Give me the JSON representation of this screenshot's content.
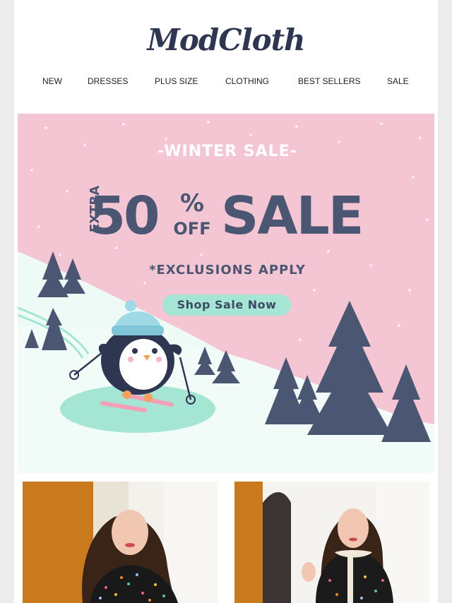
{
  "brand": {
    "name": "ModCloth"
  },
  "nav": {
    "items": [
      {
        "label": "NEW"
      },
      {
        "label": "DRESSES"
      },
      {
        "label": "PLUS SIZE"
      },
      {
        "label": "CLOTHING"
      },
      {
        "label": "BEST SELLERS"
      },
      {
        "label": "SALE"
      }
    ]
  },
  "hero": {
    "kicker": "-WINTER SALE-",
    "extra": "EXTRA",
    "percent": "50",
    "percent_sign": "%",
    "off": "OFF",
    "sale_word": "SALE",
    "exclusions": "*EXCLUSIONS APPLY",
    "cta_label": "Shop Sale Now",
    "illustration_icon": "skiing-penguin-icon"
  },
  "colors": {
    "brand_navy": "#2f3651",
    "hero_pink": "#f4c6d3",
    "hero_text": "#4b5673",
    "cta_mint": "#a5e5d3",
    "snow": "#eefaf5",
    "tree": "#4b5673"
  },
  "products": [
    {
      "image": "model-in-black-polka-dot-collared-dress"
    },
    {
      "image": "model-in-black-polka-dot-dress-with-white-collar"
    }
  ]
}
